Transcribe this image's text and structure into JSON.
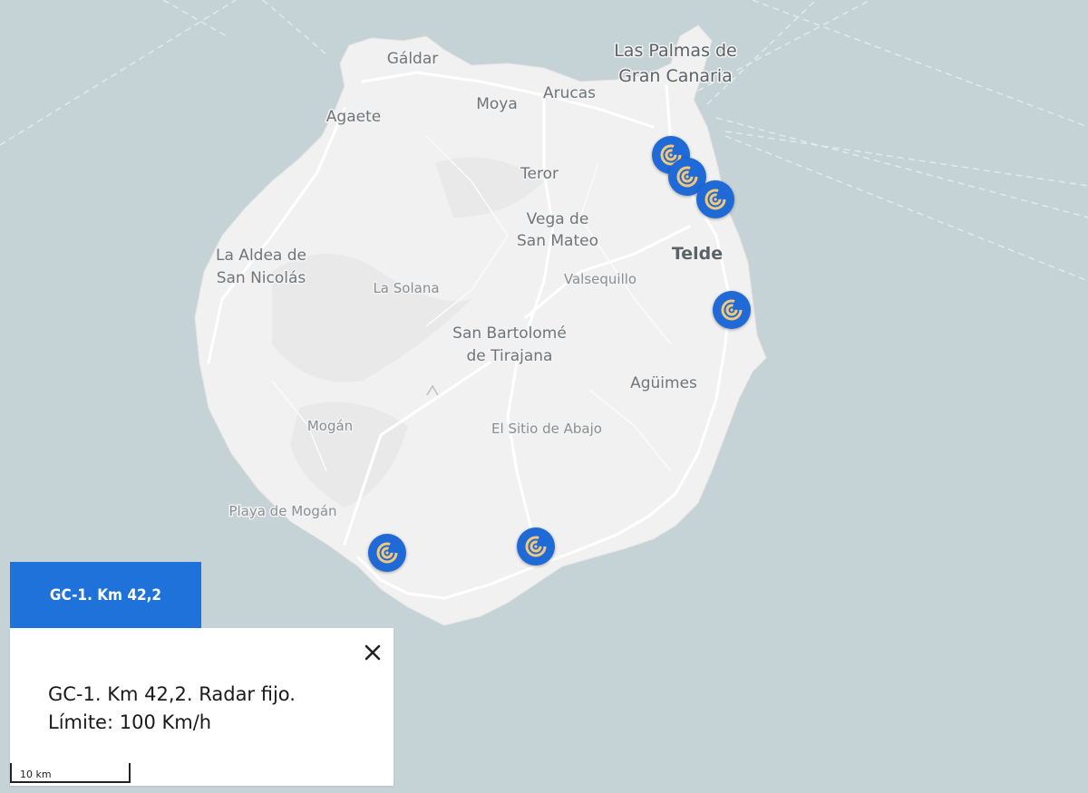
{
  "map": {
    "water_color": "#c5d2d6",
    "land_color": "#f1f1f1",
    "road_color": "#ffffff",
    "labels": {
      "las_palmas_1": "Las Palmas de",
      "las_palmas_2": "Gran Canaria",
      "galdar": "Gáldar",
      "agaete": "Agaete",
      "moya": "Moya",
      "arucas": "Arucas",
      "teror": "Teror",
      "vega_1": "Vega de",
      "vega_2": "San Mateo",
      "telde": "Telde",
      "aldea_1": "La Aldea de",
      "aldea_2": "San Nicolás",
      "la_solana": "La Solana",
      "valsequillo": "Valsequillo",
      "sanbartolome_1": "San Bartolomé",
      "sanbartolome_2": "de Tirajana",
      "aguimes": "Agüimes",
      "mogan": "Mogán",
      "sitio_abajo": "El Sitio de Abajo",
      "playa_mogan": "Playa de Mogán"
    }
  },
  "radar_markers": {
    "color": "#1f6ad6",
    "icon_color": "#f2c87a",
    "icon": "radar-target-icon"
  },
  "popup": {
    "tab_title": "GC-1. Km 42,2",
    "line1": "GC-1. Km 42,2. Radar fijo.",
    "line2": "Límite: 100 Km/h",
    "tab_color": "#1f72da",
    "close_icon": "close-icon"
  },
  "scale": {
    "label": "10 km"
  }
}
